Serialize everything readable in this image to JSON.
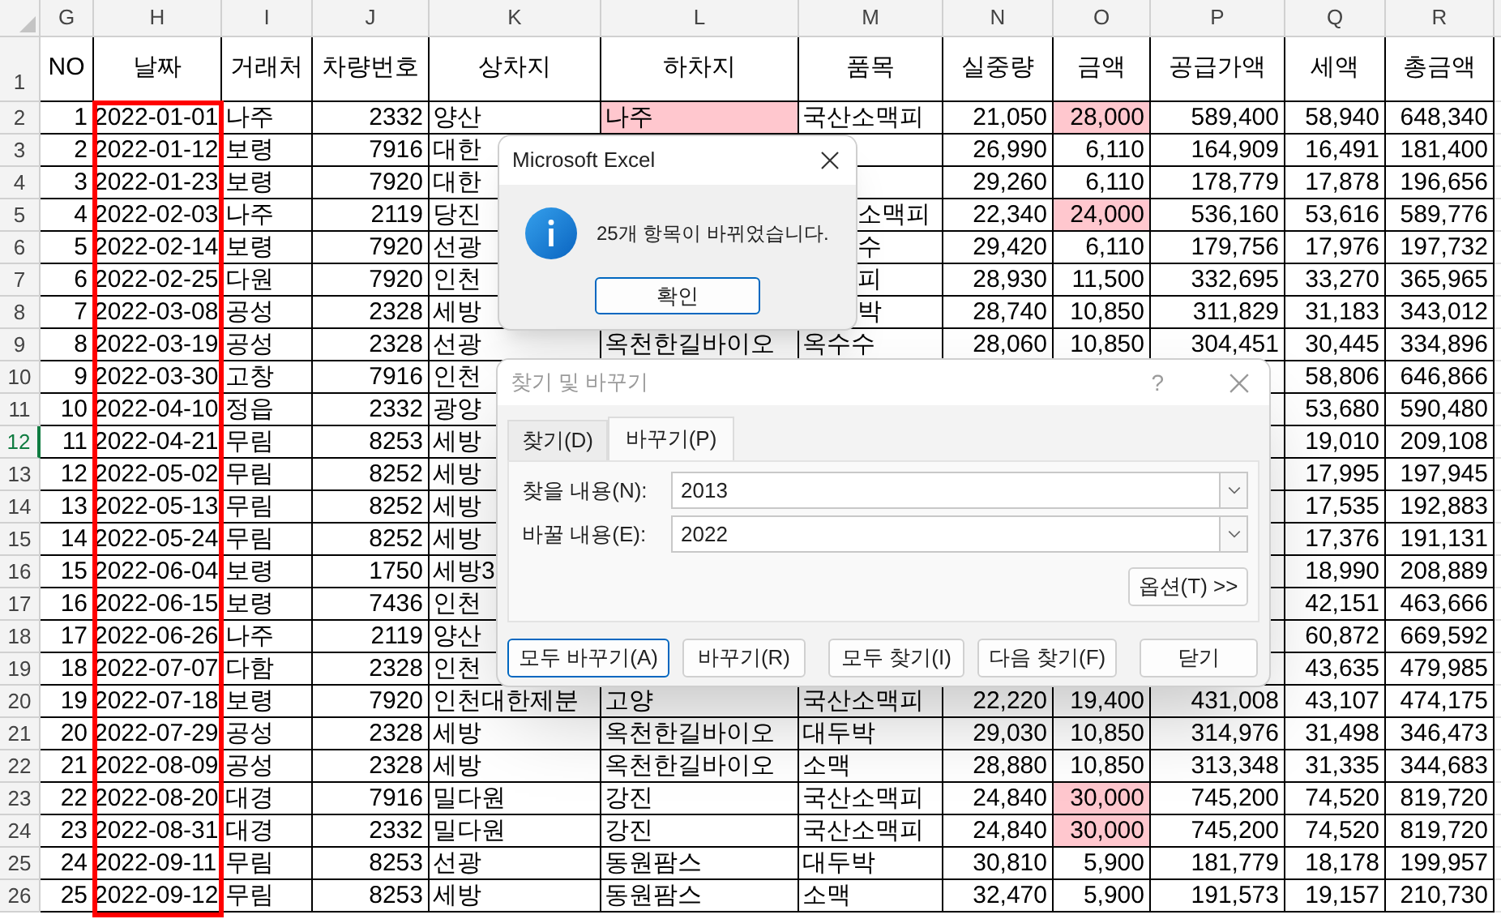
{
  "column_letters": [
    "G",
    "H",
    "I",
    "J",
    "K",
    "L",
    "M",
    "N",
    "O",
    "P",
    "Q",
    "R"
  ],
  "header_row": {
    "row_number": "1",
    "selected": false,
    "cells": [
      "NO",
      "날짜",
      "거래처",
      "차량번호",
      "상차지",
      "하차지",
      "품목",
      "실중량",
      "금액",
      "공급가액",
      "세액",
      "총금액"
    ]
  },
  "rows": [
    {
      "row_number": "2",
      "selected": false,
      "no": "1",
      "date": "2022-01-01",
      "client": "나주",
      "vehicle": "2332",
      "origin": "양산",
      "dest": "나주",
      "item": "국산소맥피",
      "weight": "21,050",
      "price": "28,000",
      "supply": "589,400",
      "tax": "58,940",
      "total": "648,340",
      "dest_flagged": true,
      "price_flagged": true,
      "item_cut": false
    },
    {
      "row_number": "3",
      "selected": false,
      "no": "2",
      "date": "2022-01-12",
      "client": "보령",
      "vehicle": "7916",
      "origin": "대한",
      "weight": "26,990",
      "price": "6,110",
      "supply": "164,909",
      "tax": "16,491",
      "total": "181,400",
      "price_flagged": false
    },
    {
      "row_number": "4",
      "selected": false,
      "no": "3",
      "date": "2022-01-23",
      "client": "보령",
      "vehicle": "7920",
      "origin": "대한",
      "weight": "29,260",
      "price": "6,110",
      "supply": "178,779",
      "tax": "17,878",
      "total": "196,656",
      "price_flagged": false
    },
    {
      "row_number": "5",
      "selected": false,
      "no": "4",
      "date": "2022-02-03",
      "client": "나주",
      "vehicle": "2119",
      "origin": "당진",
      "item": "소맥피",
      "weight": "22,340",
      "price": "24,000",
      "supply": "536,160",
      "tax": "53,616",
      "total": "589,776",
      "price_flagged": true,
      "item_cut": true
    },
    {
      "row_number": "6",
      "selected": false,
      "no": "5",
      "date": "2022-02-14",
      "client": "보령",
      "vehicle": "7920",
      "origin": "선광",
      "item": "수",
      "weight": "29,420",
      "price": "6,110",
      "supply": "179,756",
      "tax": "17,976",
      "total": "197,732",
      "price_flagged": false,
      "item_cut": true
    },
    {
      "row_number": "7",
      "selected": false,
      "no": "6",
      "date": "2022-02-25",
      "client": "다원",
      "vehicle": "7920",
      "origin": "인천",
      "item": "피",
      "weight": "28,930",
      "price": "11,500",
      "supply": "332,695",
      "tax": "33,270",
      "total": "365,965",
      "price_flagged": false,
      "item_cut": true
    },
    {
      "row_number": "8",
      "selected": false,
      "no": "7",
      "date": "2022-03-08",
      "client": "공성",
      "vehicle": "2328",
      "origin": "세방",
      "item": "박",
      "weight": "28,740",
      "price": "10,850",
      "supply": "311,829",
      "tax": "31,183",
      "total": "343,012",
      "price_flagged": false,
      "item_cut": true
    },
    {
      "row_number": "9",
      "selected": false,
      "no": "8",
      "date": "2022-03-19",
      "client": "공성",
      "vehicle": "2328",
      "origin": "선광",
      "dest": "옥천한길바이오",
      "item": "옥수수",
      "weight": "28,060",
      "price": "10,850",
      "supply": "304,451",
      "tax": "30,445",
      "total": "334,896",
      "dest_flagged": false,
      "price_flagged": false,
      "item_cut": false
    },
    {
      "row_number": "10",
      "selected": false,
      "no": "9",
      "date": "2022-03-30",
      "client": "고창",
      "vehicle": "7916",
      "origin": "인천",
      "tax": "58,806",
      "total": "646,866"
    },
    {
      "row_number": "11",
      "selected": false,
      "no": "10",
      "date": "2022-04-10",
      "client": "정읍",
      "vehicle": "2332",
      "origin": "광양",
      "tax": "53,680",
      "total": "590,480"
    },
    {
      "row_number": "12",
      "selected": true,
      "no": "11",
      "date": "2022-04-21",
      "client": "무림",
      "vehicle": "8253",
      "origin": "세방",
      "tax": "19,010",
      "total": "209,108"
    },
    {
      "row_number": "13",
      "selected": false,
      "no": "12",
      "date": "2022-05-02",
      "client": "무림",
      "vehicle": "8252",
      "origin": "세방",
      "tax": "17,995",
      "total": "197,945"
    },
    {
      "row_number": "14",
      "selected": false,
      "no": "13",
      "date": "2022-05-13",
      "client": "무림",
      "vehicle": "8252",
      "origin": "세방",
      "tax": "17,535",
      "total": "192,883"
    },
    {
      "row_number": "15",
      "selected": false,
      "no": "14",
      "date": "2022-05-24",
      "client": "무림",
      "vehicle": "8252",
      "origin": "세방",
      "tax": "17,376",
      "total": "191,131"
    },
    {
      "row_number": "16",
      "selected": false,
      "no": "15",
      "date": "2022-06-04",
      "client": "보령",
      "vehicle": "1750",
      "origin": "세방3",
      "tax": "18,990",
      "total": "208,889"
    },
    {
      "row_number": "17",
      "selected": false,
      "no": "16",
      "date": "2022-06-15",
      "client": "보령",
      "vehicle": "7436",
      "origin": "인천",
      "tax": "42,151",
      "total": "463,666"
    },
    {
      "row_number": "18",
      "selected": false,
      "no": "17",
      "date": "2022-06-26",
      "client": "나주",
      "vehicle": "2119",
      "origin": "양산",
      "tax": "60,872",
      "total": "669,592"
    },
    {
      "row_number": "19",
      "selected": false,
      "no": "18",
      "date": "2022-07-07",
      "client": "다함",
      "vehicle": "2328",
      "origin": "인천",
      "tax": "43,635",
      "total": "479,985"
    },
    {
      "row_number": "20",
      "selected": false,
      "no": "19",
      "date": "2022-07-18",
      "client": "보령",
      "vehicle": "7920",
      "origin": "인천대한제분",
      "dest": "고양",
      "item": "국산소맥피",
      "weight": "22,220",
      "price": "19,400",
      "supply": "431,008",
      "tax": "43,107",
      "total": "474,175",
      "dest_flagged": false,
      "price_flagged": false,
      "item_cut": false
    },
    {
      "row_number": "21",
      "selected": false,
      "no": "20",
      "date": "2022-07-29",
      "client": "공성",
      "vehicle": "2328",
      "origin": "세방",
      "dest": "옥천한길바이오",
      "item": "대두박",
      "weight": "29,030",
      "price": "10,850",
      "supply": "314,976",
      "tax": "31,498",
      "total": "346,473",
      "dest_flagged": false,
      "price_flagged": false,
      "item_cut": false
    },
    {
      "row_number": "22",
      "selected": false,
      "no": "21",
      "date": "2022-08-09",
      "client": "공성",
      "vehicle": "2328",
      "origin": "세방",
      "dest": "옥천한길바이오",
      "item": "소맥",
      "weight": "28,880",
      "price": "10,850",
      "supply": "313,348",
      "tax": "31,335",
      "total": "344,683",
      "dest_flagged": false,
      "price_flagged": false,
      "item_cut": false
    },
    {
      "row_number": "23",
      "selected": false,
      "no": "22",
      "date": "2022-08-20",
      "client": "대경",
      "vehicle": "7916",
      "origin": "밀다원",
      "dest": "강진",
      "item": "국산소맥피",
      "weight": "24,840",
      "price": "30,000",
      "supply": "745,200",
      "tax": "74,520",
      "total": "819,720",
      "dest_flagged": false,
      "price_flagged": true,
      "item_cut": false
    },
    {
      "row_number": "24",
      "selected": false,
      "no": "23",
      "date": "2022-08-31",
      "client": "대경",
      "vehicle": "2332",
      "origin": "밀다원",
      "dest": "강진",
      "item": "국산소맥피",
      "weight": "24,840",
      "price": "30,000",
      "supply": "745,200",
      "tax": "74,520",
      "total": "819,720",
      "dest_flagged": false,
      "price_flagged": true,
      "item_cut": false
    },
    {
      "row_number": "25",
      "selected": false,
      "no": "24",
      "date": "2022-09-11",
      "client": "무림",
      "vehicle": "8253",
      "origin": "선광",
      "dest": "동원팜스",
      "item": "대두박",
      "weight": "30,810",
      "price": "5,900",
      "supply": "181,779",
      "tax": "18,178",
      "total": "199,957",
      "dest_flagged": false,
      "price_flagged": false,
      "item_cut": false
    },
    {
      "row_number": "26",
      "selected": false,
      "no": "25",
      "date": "2022-09-12",
      "client": "무림",
      "vehicle": "8253",
      "origin": "세방",
      "dest": "동원팜스",
      "item": "소맥",
      "weight": "32,470",
      "price": "5,900",
      "supply": "191,573",
      "tax": "19,157",
      "total": "210,730",
      "dest_flagged": false,
      "price_flagged": false,
      "item_cut": false
    }
  ],
  "message_box": {
    "title": "Microsoft Excel",
    "message": "25개 항목이 바뀌었습니다.",
    "button": {
      "label": "확인",
      "focused": true
    }
  },
  "find_dialog": {
    "title": "찾기 및 바꾸기",
    "help": "?",
    "tabs": [
      {
        "label": "찾기(D)",
        "selected": false
      },
      {
        "label": "바꾸기(P)",
        "selected": true
      }
    ],
    "find_label": "찾을 내용(N):",
    "find_value": "2013",
    "replace_label": "바꿀 내용(E):",
    "replace_value": "2022",
    "options_button": "옵션(T) >>",
    "buttons": [
      {
        "label": "모두 바꾸기(A)",
        "focused": true
      },
      {
        "label": "바꾸기(R)",
        "focused": false
      },
      {
        "label": "모두 찾기(I)",
        "focused": false
      },
      {
        "label": "다음 찾기(F)",
        "focused": false
      },
      {
        "label": "닫기",
        "focused": false
      }
    ]
  }
}
